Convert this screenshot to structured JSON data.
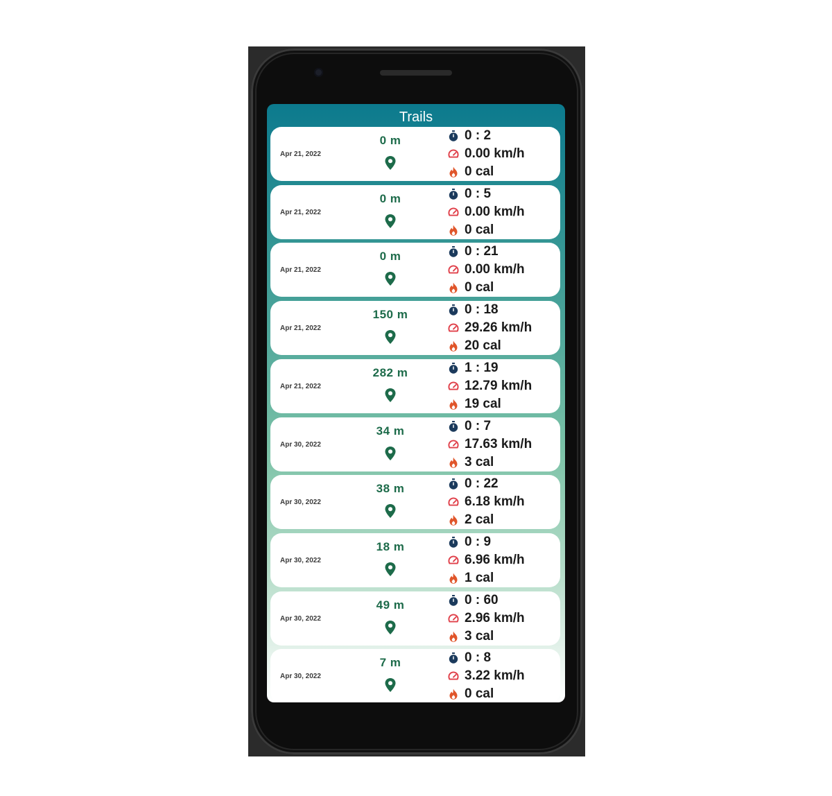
{
  "app": {
    "title": "Trails"
  },
  "trails": [
    {
      "date": "Apr 21, 2022",
      "distance": "0 m",
      "duration": "0 : 2",
      "speed": "0.00 km/h",
      "calories": "0 cal"
    },
    {
      "date": "Apr 21, 2022",
      "distance": "0 m",
      "duration": "0 : 5",
      "speed": "0.00 km/h",
      "calories": "0 cal"
    },
    {
      "date": "Apr 21, 2022",
      "distance": "0 m",
      "duration": "0 : 21",
      "speed": "0.00 km/h",
      "calories": "0 cal"
    },
    {
      "date": "Apr 21, 2022",
      "distance": "150 m",
      "duration": "0 : 18",
      "speed": "29.26 km/h",
      "calories": "20 cal"
    },
    {
      "date": "Apr 21, 2022",
      "distance": "282 m",
      "duration": "1 : 19",
      "speed": "12.79 km/h",
      "calories": "19 cal"
    },
    {
      "date": "Apr 30, 2022",
      "distance": "34 m",
      "duration": "0 : 7",
      "speed": "17.63 km/h",
      "calories": "3 cal"
    },
    {
      "date": "Apr 30, 2022",
      "distance": "38 m",
      "duration": "0 : 22",
      "speed": "6.18 km/h",
      "calories": "2 cal"
    },
    {
      "date": "Apr 30, 2022",
      "distance": "18 m",
      "duration": "0 : 9",
      "speed": "6.96 km/h",
      "calories": "1 cal"
    },
    {
      "date": "Apr 30, 2022",
      "distance": "49 m",
      "duration": "0 : 60",
      "speed": "2.96 km/h",
      "calories": "3 cal"
    },
    {
      "date": "Apr 30, 2022",
      "distance": "7 m",
      "duration": "0 : 8",
      "speed": "3.22 km/h",
      "calories": "0 cal"
    }
  ],
  "icons": {
    "duration": "stopwatch-icon",
    "speed": "speedometer-icon",
    "calories": "flame-icon",
    "location": "map-pin-icon"
  },
  "colors": {
    "header": "#0c7a8e",
    "distance_text": "#1d6b4a",
    "stopwatch": "#1b3a5c",
    "speedometer": "#e0404a",
    "flame": "#e0552a",
    "pin": "#1d6b4a"
  }
}
